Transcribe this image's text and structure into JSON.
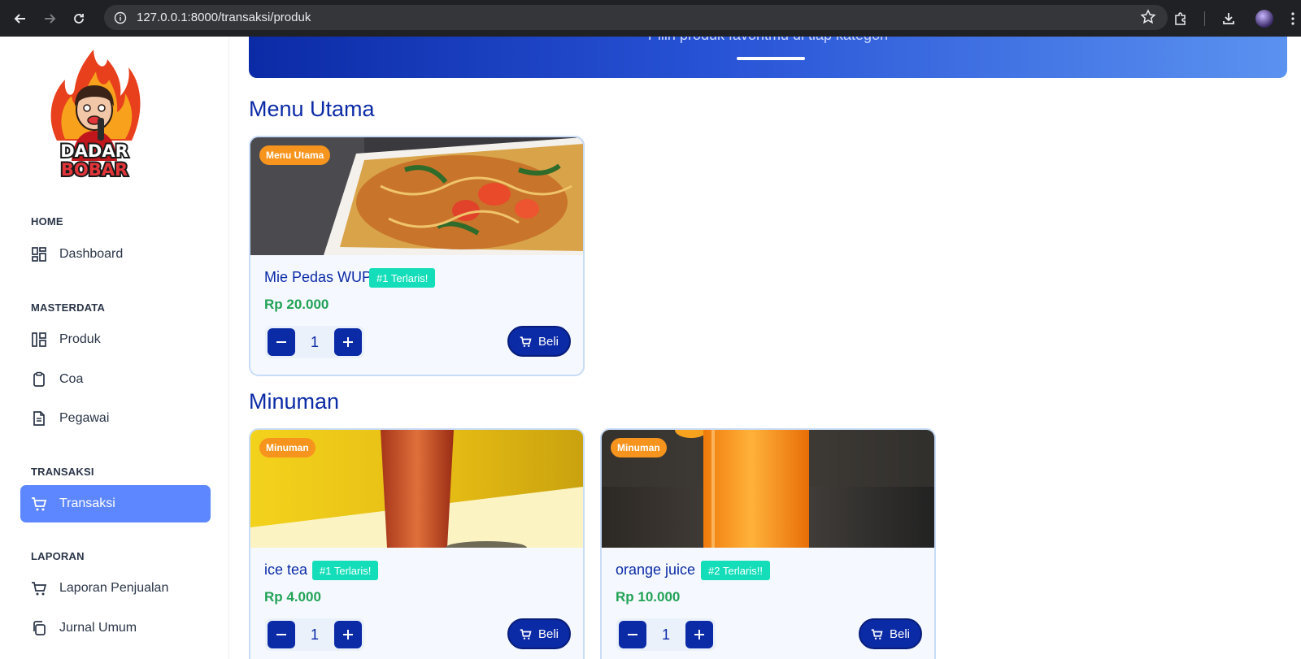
{
  "browser": {
    "url": "127.0.0.1:8000/transaksi/produk"
  },
  "brand": {
    "logo_text_top": "DADAR",
    "logo_text_bottom": "BOBAR"
  },
  "sidebar": {
    "sections": [
      {
        "title": "HOME",
        "items": [
          {
            "label": "Dashboard",
            "icon": "dashboard-icon"
          }
        ]
      },
      {
        "title": "MASTERDATA",
        "items": [
          {
            "label": "Produk",
            "icon": "layout-icon"
          },
          {
            "label": "Coa",
            "icon": "clipboard-icon"
          },
          {
            "label": "Pegawai",
            "icon": "file-text-icon"
          }
        ]
      },
      {
        "title": "TRANSAKSI",
        "items": [
          {
            "label": "Transaksi",
            "icon": "cart-icon",
            "active": true
          }
        ]
      },
      {
        "title": "LAPORAN",
        "items": [
          {
            "label": "Laporan Penjualan",
            "icon": "cart-icon"
          },
          {
            "label": "Jurnal Umum",
            "icon": "copy-icon"
          }
        ]
      }
    ]
  },
  "hero": {
    "subtitle": "Pilih produk favoritmu di tiap kategori"
  },
  "categories": [
    {
      "title": "Menu Utama",
      "products": [
        {
          "badge": "Menu Utama",
          "name": "Mie Pedas WUP",
          "rank": "#1 Terlaris!",
          "price": "Rp 20.000",
          "qty": "1",
          "buy_label": "Beli"
        }
      ]
    },
    {
      "title": "Minuman",
      "products": [
        {
          "badge": "Minuman",
          "name": "ice tea",
          "rank": "#1 Terlaris!",
          "price": "Rp 4.000",
          "qty": "1",
          "buy_label": "Beli"
        },
        {
          "badge": "Minuman",
          "name": "orange juice",
          "rank": "#2 Terlaris!!",
          "price": "Rp 10.000",
          "qty": "1",
          "buy_label": "Beli"
        }
      ]
    }
  ],
  "colors": {
    "primary": "#0b2aa6",
    "sidebar_active": "#5d87ff",
    "badge": "#f7941d",
    "rank": "#13deb9",
    "price": "#22a257"
  }
}
